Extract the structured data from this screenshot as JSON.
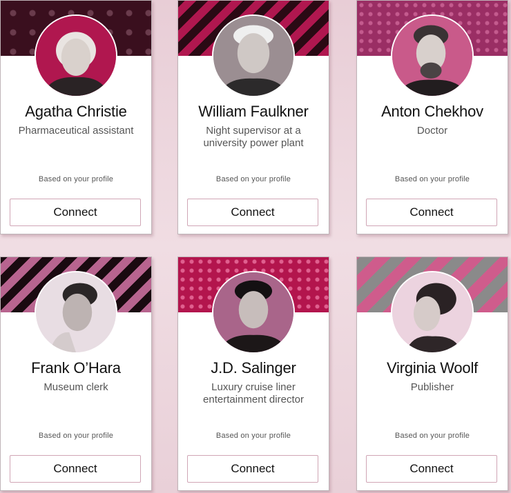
{
  "cards": [
    {
      "name": "Agatha Christie",
      "title": "Pharmaceutical assistant",
      "caption": "Based on your profile",
      "button": "Connect",
      "banner": "dark-dots",
      "avatar_color": "#b0174f"
    },
    {
      "name": "William Faulkner",
      "title": "Night supervisor at a university power plant",
      "caption": "Based on your profile",
      "button": "Connect",
      "banner": "red-black-stripes",
      "avatar_color": "#9b8e92"
    },
    {
      "name": "Anton Chekhov",
      "title": "Doctor",
      "caption": "Based on your profile",
      "button": "Connect",
      "banner": "plum-dots",
      "avatar_color": "#c95a8a"
    },
    {
      "name": "Frank O’Hara",
      "title": "Museum clerk",
      "caption": "Based on your profile",
      "button": "Connect",
      "banner": "pink-black-stripes",
      "avatar_color": "#e8dde3"
    },
    {
      "name": "J.D. Salinger",
      "title": "Luxury cruise liner entertainment director",
      "caption": "Based on your profile",
      "button": "Connect",
      "banner": "crimson-dots",
      "avatar_color": "#a9658a"
    },
    {
      "name": "Virginia Woolf",
      "title": "Publisher",
      "caption": "Based on your profile",
      "button": "Connect",
      "banner": "grey-pink-stripes",
      "avatar_color": "#ecd3df"
    }
  ]
}
